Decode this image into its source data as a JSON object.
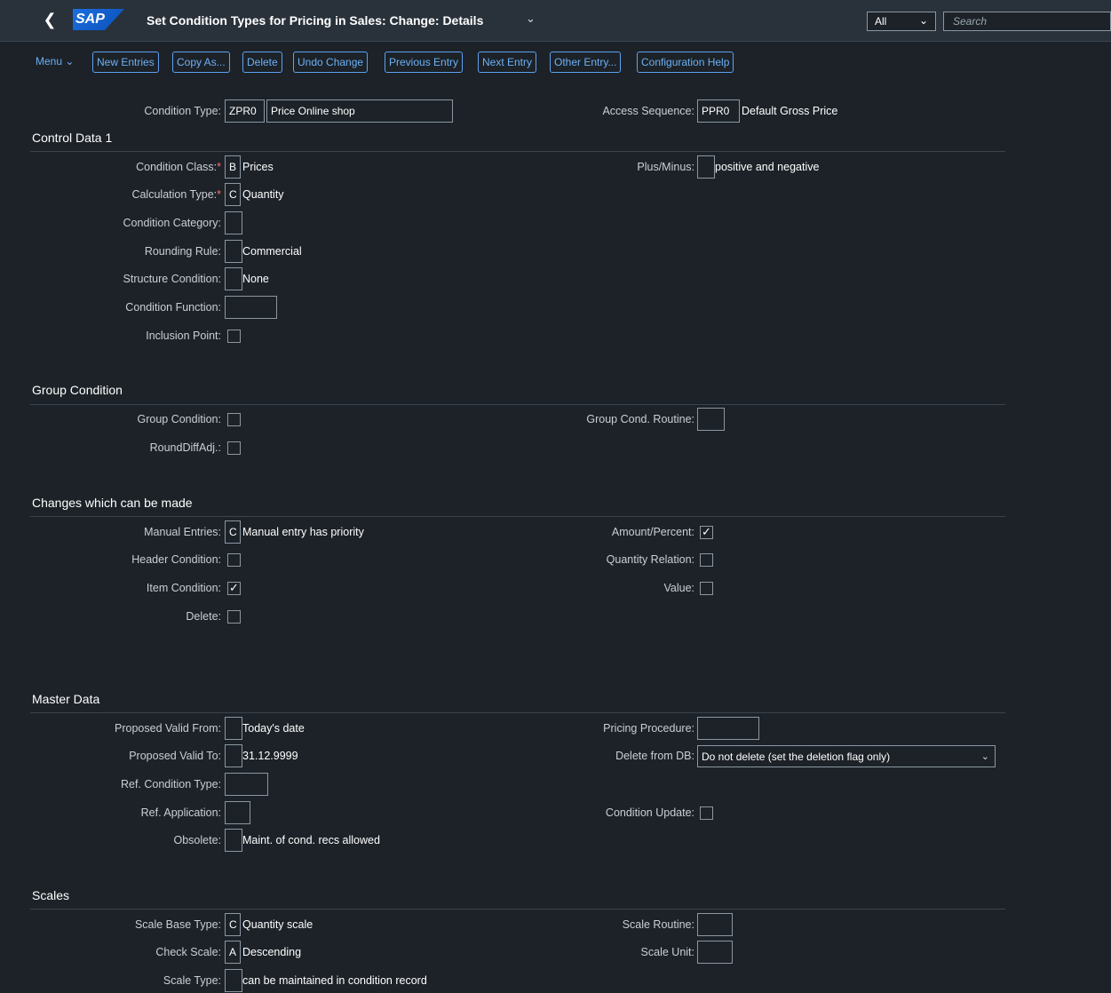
{
  "shell": {
    "title": "Set Condition Types for Pricing in Sales: Change: Details",
    "logo": "SAP",
    "scope": "All",
    "search_placeholder": "Search"
  },
  "toolbar": {
    "menu": "Menu",
    "buttons": [
      "New Entries",
      "Copy As...",
      "Delete",
      "Undo Change",
      "Previous Entry",
      "Next Entry",
      "Other Entry...",
      "Configuration Help"
    ]
  },
  "header": {
    "condition_type_label": "Condition Type:",
    "condition_type_code": "ZPR0",
    "condition_type_name": "Price Online shop",
    "access_sequence_label": "Access Sequence:",
    "access_sequence_code": "PPR0",
    "access_sequence_desc": "Default Gross Price"
  },
  "control_data": {
    "title": "Control Data 1",
    "condition_class_label": "Condition Class:",
    "condition_class_value": "B",
    "condition_class_desc": "Prices",
    "calculation_type_label": "Calculation Type:",
    "calculation_type_value": "C",
    "calculation_type_desc": "Quantity",
    "condition_category_label": "Condition Category:",
    "rounding_rule_label": "Rounding Rule:",
    "rounding_rule_desc": "Commercial",
    "structure_condition_label": "Structure Condition:",
    "structure_condition_desc": "None",
    "condition_function_label": "Condition Function:",
    "inclusion_point_label": "Inclusion Point:",
    "plus_minus_label": "Plus/Minus:",
    "plus_minus_desc": "positive and negative"
  },
  "group_condition": {
    "title": "Group Condition",
    "group_condition_label": "Group Condition:",
    "round_diff_label": "RoundDiffAdj.:",
    "group_routine_label": "Group Cond. Routine:"
  },
  "changes": {
    "title": "Changes which can be made",
    "manual_entries_label": "Manual Entries:",
    "manual_entries_value": "C",
    "manual_entries_desc": "Manual entry has priority",
    "header_condition_label": "Header Condition:",
    "item_condition_label": "Item Condition:",
    "item_condition_checked": true,
    "delete_label": "Delete:",
    "amount_percent_label": "Amount/Percent:",
    "amount_percent_checked": true,
    "quantity_relation_label": "Quantity Relation:",
    "value_label": "Value:"
  },
  "master_data": {
    "title": "Master Data",
    "valid_from_label": "Proposed Valid From:",
    "valid_from_desc": "Today's date",
    "valid_to_label": "Proposed Valid To:",
    "valid_to_desc": "31.12.9999",
    "ref_condition_type_label": "Ref. Condition Type:",
    "ref_application_label": "Ref. Application:",
    "obsolete_label": "Obsolete:",
    "obsolete_desc": "Maint. of cond. recs allowed",
    "pricing_procedure_label": "Pricing Procedure:",
    "delete_from_db_label": "Delete from DB:",
    "delete_from_db_value": "Do not delete (set the deletion flag only)",
    "condition_update_label": "Condition Update:"
  },
  "scales": {
    "title": "Scales",
    "scale_base_type_label": "Scale Base Type:",
    "scale_base_type_value": "C",
    "scale_base_type_desc": "Quantity scale",
    "check_scale_label": "Check Scale:",
    "check_scale_value": "A",
    "check_scale_desc": "Descending",
    "scale_type_label": "Scale Type:",
    "scale_type_desc": "can be maintained in condition record",
    "scale_routine_label": "Scale Routine:",
    "scale_unit_label": "Scale Unit:"
  }
}
